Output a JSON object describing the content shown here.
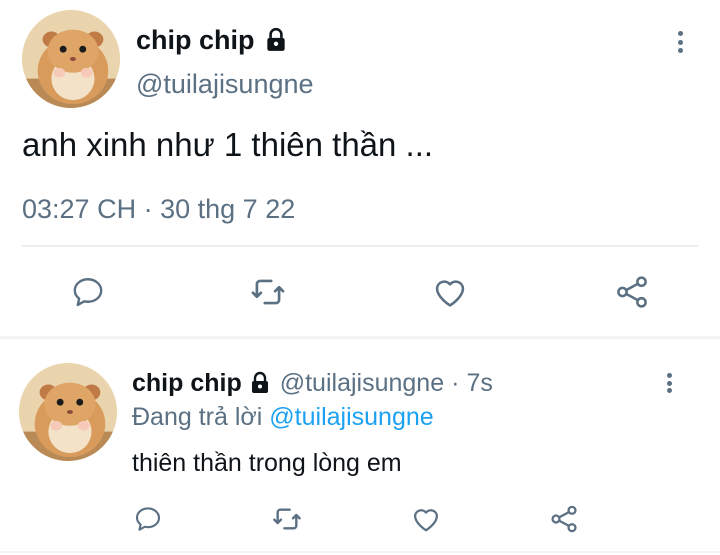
{
  "main_tweet": {
    "display_name": "chip chip",
    "handle": "@tuilajisungne",
    "text": "anh xinh như 1 thiên thần ...",
    "time": "03:27 CH",
    "separator": "·",
    "date": "30 thg 7 22",
    "actions": [
      "reply-icon",
      "retweet-icon",
      "like-icon",
      "share-icon"
    ]
  },
  "reply_tweet": {
    "display_name": "chip chip",
    "handle": "@tuilajisungne",
    "separator": "·",
    "age": "7s",
    "replying_prefix": "Đang trả lời",
    "replying_to": "@tuilajisungne",
    "text": "thiên thần trong lòng em",
    "actions": [
      "reply-icon",
      "retweet-icon",
      "like-icon",
      "share-icon"
    ]
  },
  "colors": {
    "text": "#0f1419",
    "secondary": "#5b7083",
    "link": "#1da1f2",
    "divider": "#ebeef0"
  }
}
